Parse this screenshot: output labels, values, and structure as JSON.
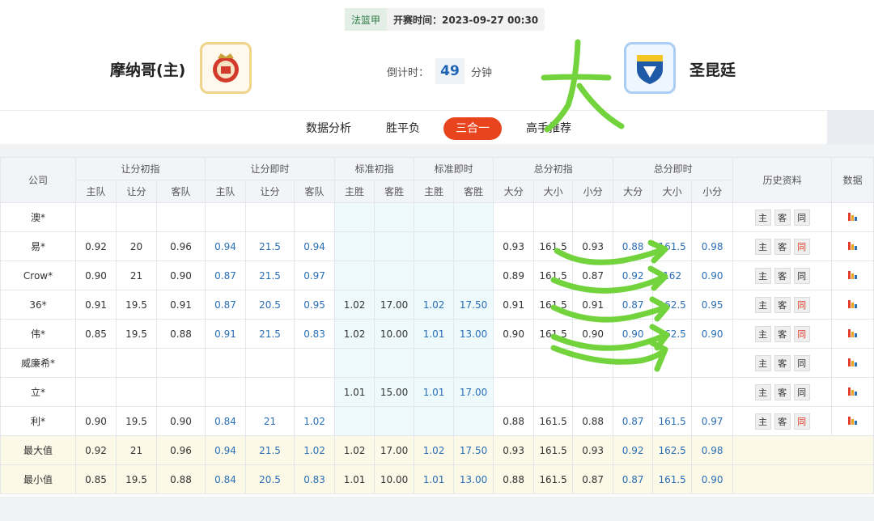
{
  "match": {
    "league": "法篮甲",
    "start_time": "开赛时间：2023-09-27 00:30",
    "home": "摩纳哥(主)",
    "away": "圣昆廷",
    "countdown_label": "倒计时：",
    "countdown_value": "49",
    "countdown_unit": "分钟"
  },
  "tabs": [
    "数据分析",
    "胜平负",
    "三合一",
    "高手推荐"
  ],
  "active_tab": "三合一",
  "table": {
    "groups": [
      "公司",
      "让分初指",
      "让分即时",
      "标准初指",
      "标准即时",
      "总分初指",
      "总分即时",
      "历史资料",
      "数据"
    ],
    "subheaders": [
      "主队",
      "让分",
      "客队",
      "主队",
      "让分",
      "客队",
      "主胜",
      "客胜",
      "主胜",
      "客胜",
      "大分",
      "大小",
      "小分",
      "大分",
      "大小",
      "小分"
    ],
    "rows": [
      {
        "company": "澳*",
        "v": [
          "",
          "",
          "",
          "",
          "",
          "",
          "",
          "",
          "",
          "",
          "",
          "",
          "",
          "",
          "",
          ""
        ],
        "tong_red": false
      },
      {
        "company": "易*",
        "v": [
          "0.92",
          "20",
          "0.96",
          "0.94",
          "21.5",
          "0.94",
          "",
          "",
          "",
          "",
          "0.93",
          "161.5",
          "0.93",
          "0.88",
          "161.5",
          "0.98"
        ],
        "tong_red": true
      },
      {
        "company": "Crow*",
        "v": [
          "0.90",
          "21",
          "0.90",
          "0.87",
          "21.5",
          "0.97",
          "",
          "",
          "",
          "",
          "0.89",
          "161.5",
          "0.87",
          "0.92",
          "162",
          "0.90"
        ],
        "tong_red": false
      },
      {
        "company": "36*",
        "v": [
          "0.91",
          "19.5",
          "0.91",
          "0.87",
          "20.5",
          "0.95",
          "1.02",
          "17.00",
          "1.02",
          "17.50",
          "0.91",
          "161.5",
          "0.91",
          "0.87",
          "162.5",
          "0.95"
        ],
        "tong_red": true
      },
      {
        "company": "伟*",
        "v": [
          "0.85",
          "19.5",
          "0.88",
          "0.91",
          "21.5",
          "0.83",
          "1.02",
          "10.00",
          "1.01",
          "13.00",
          "0.90",
          "161.5",
          "0.90",
          "0.90",
          "162.5",
          "0.90"
        ],
        "tong_red": true
      },
      {
        "company": "威廉希*",
        "v": [
          "",
          "",
          "",
          "",
          "",
          "",
          "",
          "",
          "",
          "",
          "",
          "",
          "",
          "",
          "",
          ""
        ],
        "tong_red": false
      },
      {
        "company": "立*",
        "v": [
          "",
          "",
          "",
          "",
          "",
          "",
          "1.01",
          "15.00",
          "1.01",
          "17.00",
          "",
          "",
          "",
          "",
          "",
          ""
        ],
        "tong_red": false
      },
      {
        "company": "利*",
        "v": [
          "0.90",
          "19.5",
          "0.90",
          "0.84",
          "21",
          "1.02",
          "",
          "",
          "",
          "",
          "0.88",
          "161.5",
          "0.88",
          "0.87",
          "161.5",
          "0.97"
        ],
        "tong_red": true
      }
    ],
    "summary": [
      {
        "label": "最大值",
        "v": [
          "0.92",
          "21",
          "0.96",
          "0.94",
          "21.5",
          "1.02",
          "1.02",
          "17.00",
          "1.02",
          "17.50",
          "0.93",
          "161.5",
          "0.93",
          "0.92",
          "162.5",
          "0.98"
        ]
      },
      {
        "label": "最小值",
        "v": [
          "0.85",
          "19.5",
          "0.88",
          "0.84",
          "20.5",
          "0.83",
          "1.01",
          "10.00",
          "1.01",
          "13.00",
          "0.88",
          "161.5",
          "0.87",
          "0.87",
          "161.5",
          "0.90"
        ]
      }
    ],
    "history_buttons": [
      "主",
      "客",
      "同"
    ]
  },
  "annotation": {
    "text": "大",
    "color": "#72d33c"
  },
  "colors": {
    "accent": "#e8451e",
    "blue": "#2a6fb5",
    "red": "#e23d2a"
  }
}
